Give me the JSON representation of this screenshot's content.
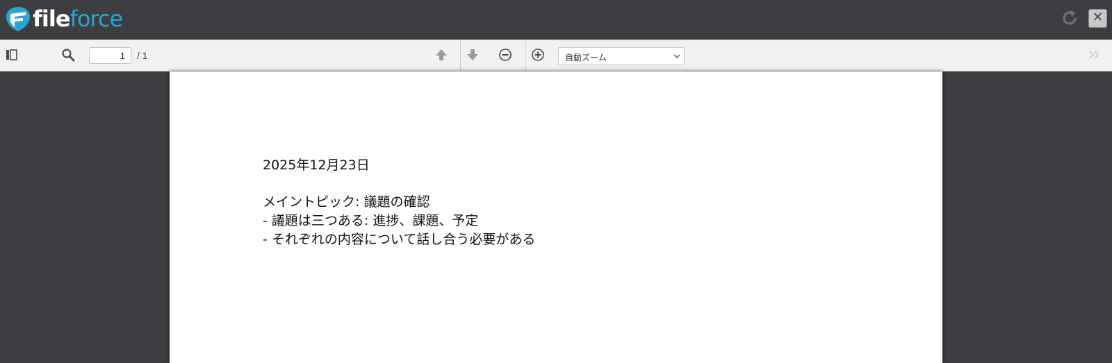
{
  "brand": {
    "name_part1": "file",
    "name_part2": "force",
    "accent_color": "#2aa5d3"
  },
  "header": {
    "reload_icon": "reload-icon",
    "close_label": "✕"
  },
  "toolbar": {
    "sidebar_toggle_icon": "sidebar-toggle-icon",
    "search_icon": "search-icon",
    "page_number": "1",
    "page_total": "/ 1",
    "prev_page_icon": "arrow-up-icon",
    "next_page_icon": "arrow-down-icon",
    "zoom_out_icon": "zoom-out-icon",
    "zoom_in_icon": "zoom-in-icon",
    "zoom_value": "自動ズーム",
    "more_tools_icon": "double-chevron-right-icon"
  },
  "document": {
    "lines": [
      "2025年12月23日",
      "メイントピック: 議題の確認",
      "- 議題は三つある: 進捗、課題、予定",
      "- それぞれの内容について話し合う必要がある"
    ]
  }
}
